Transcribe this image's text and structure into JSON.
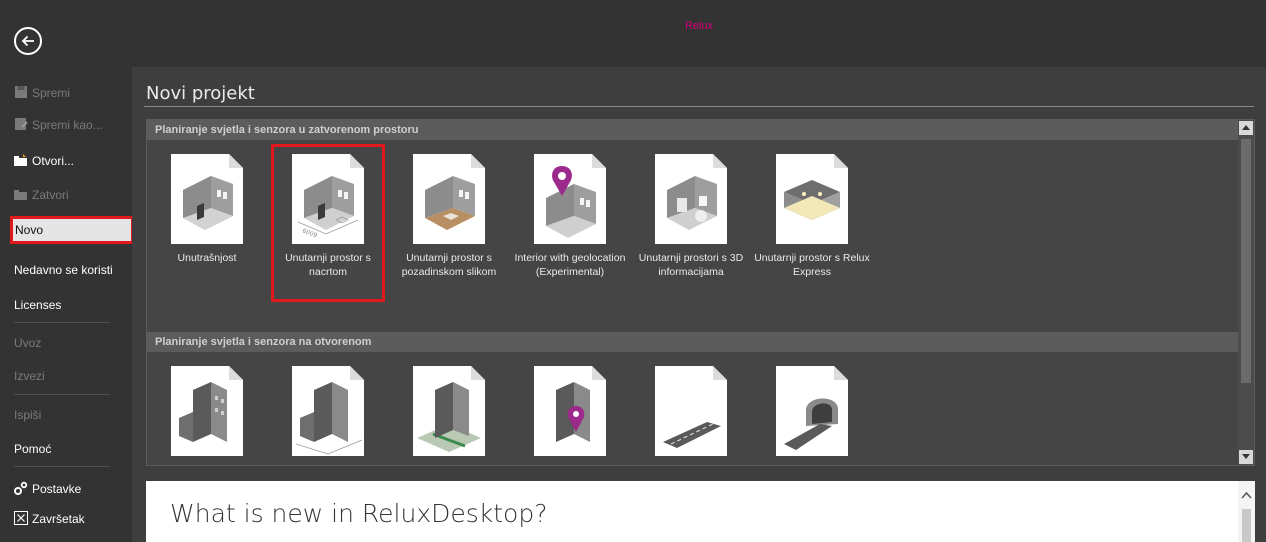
{
  "app": {
    "title": "Relux"
  },
  "sidebar": {
    "items": [
      {
        "label": "Spremi",
        "enabled": false,
        "icon": "save-icon"
      },
      {
        "label": "Spremi kao...",
        "enabled": false,
        "icon": "save-as-icon"
      },
      {
        "label": "Otvori...",
        "enabled": true,
        "icon": "open-folder-icon"
      },
      {
        "label": "Zatvori",
        "enabled": false,
        "icon": "close-folder-icon"
      },
      {
        "label": "Novo",
        "enabled": true,
        "selected": true
      },
      {
        "label": "Nedavno se koristi",
        "enabled": true
      },
      {
        "label": "Licenses",
        "enabled": true
      },
      {
        "label": "Uvoz",
        "enabled": false
      },
      {
        "label": "Izvezi",
        "enabled": false
      },
      {
        "label": "Ispiši",
        "enabled": false
      },
      {
        "label": "Pomoć",
        "enabled": true
      },
      {
        "label": "Postavke",
        "enabled": true,
        "icon": "settings-gears-icon"
      },
      {
        "label": "Završetak",
        "enabled": true,
        "icon": "exit-box-icon"
      }
    ]
  },
  "main": {
    "title": "Novi projekt",
    "sections": [
      {
        "header": "Planiranje svjetla i senzora u zatvorenom prostoru",
        "tiles": [
          {
            "label": "Unutrašnjost",
            "icon": "room-icon"
          },
          {
            "label": "Unutarnji prostor s nacrtom",
            "icon": "room-plan-icon",
            "selected": true
          },
          {
            "label": "Unutarnji prostor s pozadinskom slikom",
            "icon": "room-background-icon"
          },
          {
            "label": "Interior with geolocation (Experimental)",
            "icon": "room-geolocation-icon"
          },
          {
            "label": "Unutarnji prostori s 3D informacijama",
            "icon": "room-3d-icon"
          },
          {
            "label": "Unutarnji prostor s Relux Express",
            "icon": "room-express-icon"
          }
        ]
      },
      {
        "header": "Planiranje svjetla i senzora na otvorenom",
        "tiles": [
          {
            "label": "",
            "icon": "building-icon"
          },
          {
            "label": "",
            "icon": "building-plan-icon"
          },
          {
            "label": "",
            "icon": "building-map-icon"
          },
          {
            "label": "",
            "icon": "building-geolocation-icon"
          },
          {
            "label": "",
            "icon": "road-icon"
          },
          {
            "label": "",
            "icon": "tunnel-icon"
          }
        ]
      }
    ]
  },
  "news": {
    "title": "What is new in ReluxDesktop?"
  },
  "colors": {
    "accent": "#d6007e",
    "highlight": "#e0191c",
    "pin": "#9b2a8c"
  }
}
